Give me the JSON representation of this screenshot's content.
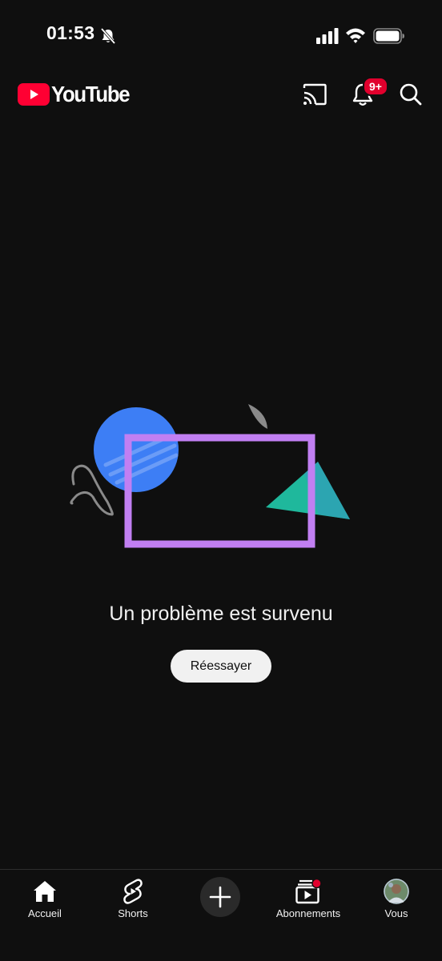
{
  "status_bar": {
    "time": "01:53"
  },
  "header": {
    "logo_text": "YouTube",
    "notification_badge": "9+",
    "brand_color": "#ff0033"
  },
  "error": {
    "message": "Un problème est survenu",
    "retry_label": "Réessayer"
  },
  "bottom_nav": {
    "items": [
      {
        "label": "Accueil",
        "icon": "home-icon"
      },
      {
        "label": "Shorts",
        "icon": "shorts-icon"
      },
      {
        "label": "",
        "icon": "create-icon"
      },
      {
        "label": "Abonnements",
        "icon": "subscriptions-icon"
      },
      {
        "label": "Vous",
        "icon": "avatar"
      }
    ]
  },
  "colors": {
    "background": "#0f0f0f",
    "badge": "#e1002d",
    "illustration_circle": "#3d7ef5",
    "illustration_frame": "#c17ff2",
    "illustration_triangle": "#1fb89c"
  }
}
